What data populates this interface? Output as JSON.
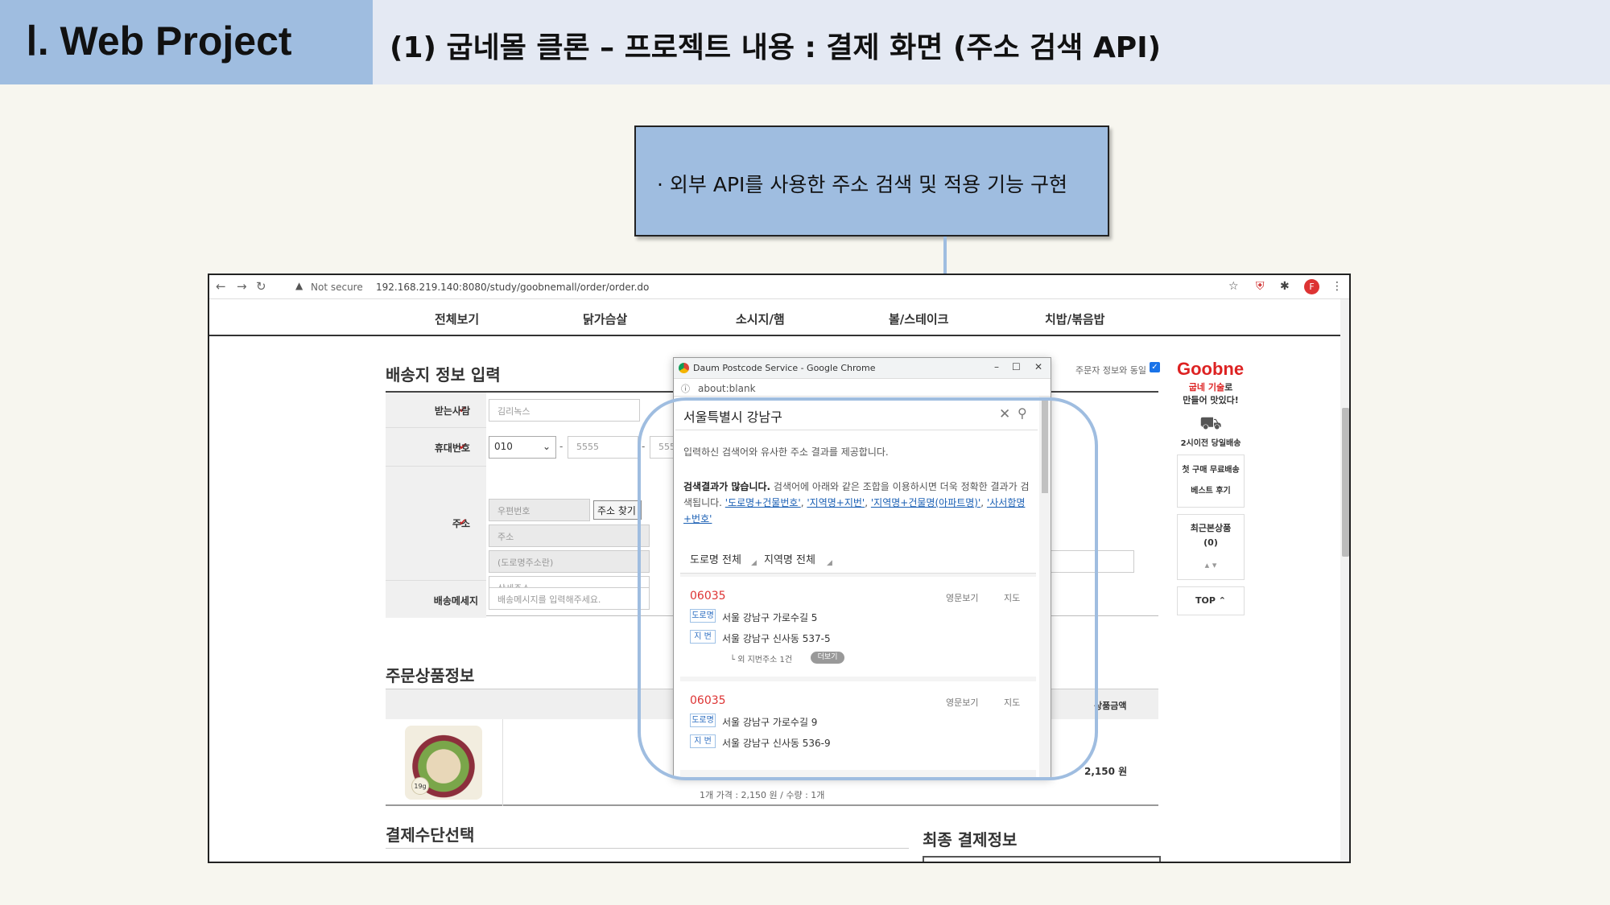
{
  "header": {
    "section": "Ⅰ. Web Project",
    "title": "(1) 굽네몰 클론 – 프로젝트 내용 : 결제 화면 (주소 검색 API)"
  },
  "callout": {
    "text": "· 외부 API를 사용한 주소 검색 및 적용 기능 구현"
  },
  "browser": {
    "not_secure": "Not secure",
    "url": "192.168.219.140:8080/study/goobnemall/order/order.do",
    "avatar": "F"
  },
  "nav": [
    "전체보기",
    "닭가슴살",
    "소시지/햄",
    "볼/스테이크",
    "치밥/볶음밥"
  ],
  "order_form": {
    "title": "배송지 정보 입력",
    "same_as_orderer": "주문자 정보와 동일",
    "receiver_label": "받는사람",
    "receiver_value": "김리녹스",
    "phone_label": "휴대번호",
    "phone_prefix": "010",
    "phone_mid": "5555",
    "phone_last": "5555",
    "address_label": "주소",
    "zip_placeholder": "우편번호",
    "zip_button": "주소 찾기",
    "addr_placeholder": "주소",
    "road_placeholder": "(도로명주소란)",
    "detail_placeholder": "상세주소",
    "message_label": "배송메세지",
    "message_placeholder": "배송메시지를 입력해주세요."
  },
  "product_section": {
    "title": "주문상품정보",
    "col_amount": "상품금액",
    "price": "2,150 원",
    "unit_line": "1개 가격 : 2,150 원 / 수량 : 1개",
    "badge": "19g"
  },
  "payment_section": {
    "title": "결제수단선택"
  },
  "final_section": {
    "title": "최종 결제정보"
  },
  "sidebar": {
    "logo": "Goobne",
    "slogan_red": "굽네 기술",
    "slogan_rest": "로",
    "slogan_line2": "만들어 맛있다!",
    "delivery": "2시이전 당일배송",
    "free_ship": "첫 구매 무료배송",
    "best_review": "베스트 후기",
    "recent": "최근본상품",
    "recent_count": "(0)",
    "top": "TOP"
  },
  "popup": {
    "window_title": "Daum Postcode Service - Google Chrome",
    "url": "about:blank",
    "query": "서울특별시 강남구",
    "info": "입력하신 검색어와 유사한 주소 결과를 제공합니다.",
    "tip_bold": "검색결과가 많습니다.",
    "tip_text": " 검색어에 아래와 같은 조합을 이용하시면 더욱 정확한 결과가 검색됩니다. ",
    "tip_links": [
      "'도로명+건물번호'",
      "'지역명+지번'",
      "'지역명+건물명(아파트명)'",
      "'사서함명+번호'"
    ],
    "tab_road": "도로명 전체",
    "tab_region": "지역명 전체",
    "results": [
      {
        "zip": "06035",
        "road_tag": "도로명",
        "road": "서울 강남구 가로수길 5",
        "jibun_tag": "지 번",
        "jibun": "서울 강남구 신사동 537-5",
        "more": "└ 외 지번주소 1건",
        "more_btn": "더보기"
      },
      {
        "zip": "06035",
        "road_tag": "도로명",
        "road": "서울 강남구 가로수길 9",
        "jibun_tag": "지 번",
        "jibun": "서울 강남구 신사동 536-9"
      }
    ],
    "eng_label": "영문보기",
    "map_label": "지도"
  }
}
